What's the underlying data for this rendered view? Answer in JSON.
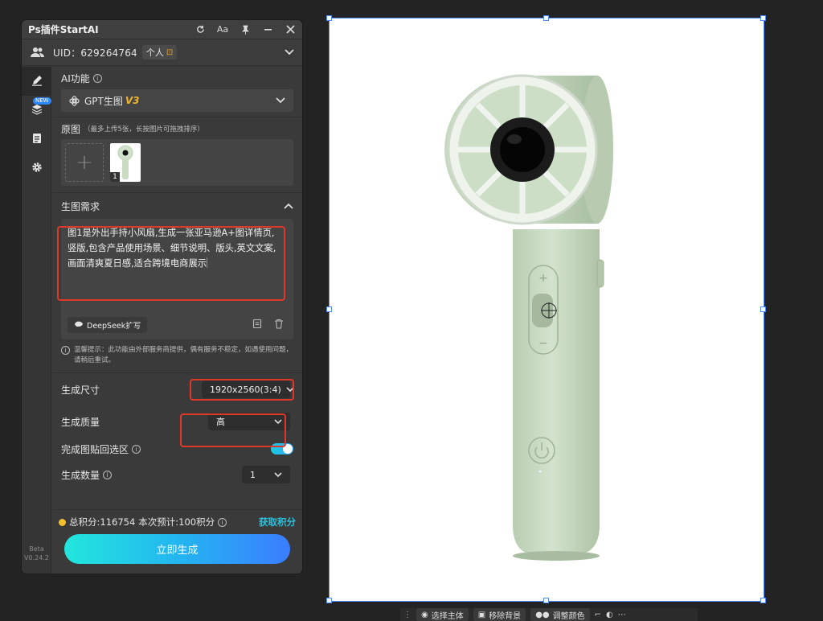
{
  "panel": {
    "title": "Ps插件StartAI",
    "uid_label": "UID：629264764",
    "account_type": "个人",
    "sidebar": {
      "new_tag": "NEW",
      "beta_label": "Beta",
      "version": "V0.24.2"
    },
    "ai_function": {
      "label": "AI功能",
      "model": "GPT生图",
      "model_version": "V3"
    },
    "source_images": {
      "label": "原图",
      "hint": "（最多上传5张，长按图片可拖拽排序）",
      "thumb_index": "1"
    },
    "prompt_section": {
      "label": "生图需求",
      "text": "图1是外出手持小风扇,生成一张亚马逊A+图详情页,竖版,包含产品使用场景、细节说明、版头,英文文案,画面清爽夏日感,适合跨境电商展示",
      "deepseek_button": "DeepSeek扩写"
    },
    "tip": "温馨提示：此功能由外部服务商提供，偶有服务不稳定，如遇使用问题，请稍后重试。",
    "size": {
      "label": "生成尺寸",
      "value": "1920x2560(3:4)"
    },
    "quality": {
      "label": "生成质量",
      "value": "高"
    },
    "paste_back": {
      "label": "完成图贴回选区",
      "enabled": true
    },
    "count": {
      "label": "生成数量",
      "value": "1"
    },
    "footer": {
      "total_points": "总积分:116754",
      "estimate": "本次预计:100积分",
      "get_points": "获取积分",
      "generate_button": "立即生成"
    }
  },
  "canvas_toolbar": {
    "select_subject": "选择主体",
    "remove_bg": "移除背景",
    "adjust_color": "调整颜色"
  },
  "colors": {
    "accent_cyan": "#27c3e0",
    "accent_blue": "#3a7dff",
    "highlight_red": "#e0372b",
    "points_yellow": "#f5c02a",
    "product_green": "#c9dcc2"
  }
}
